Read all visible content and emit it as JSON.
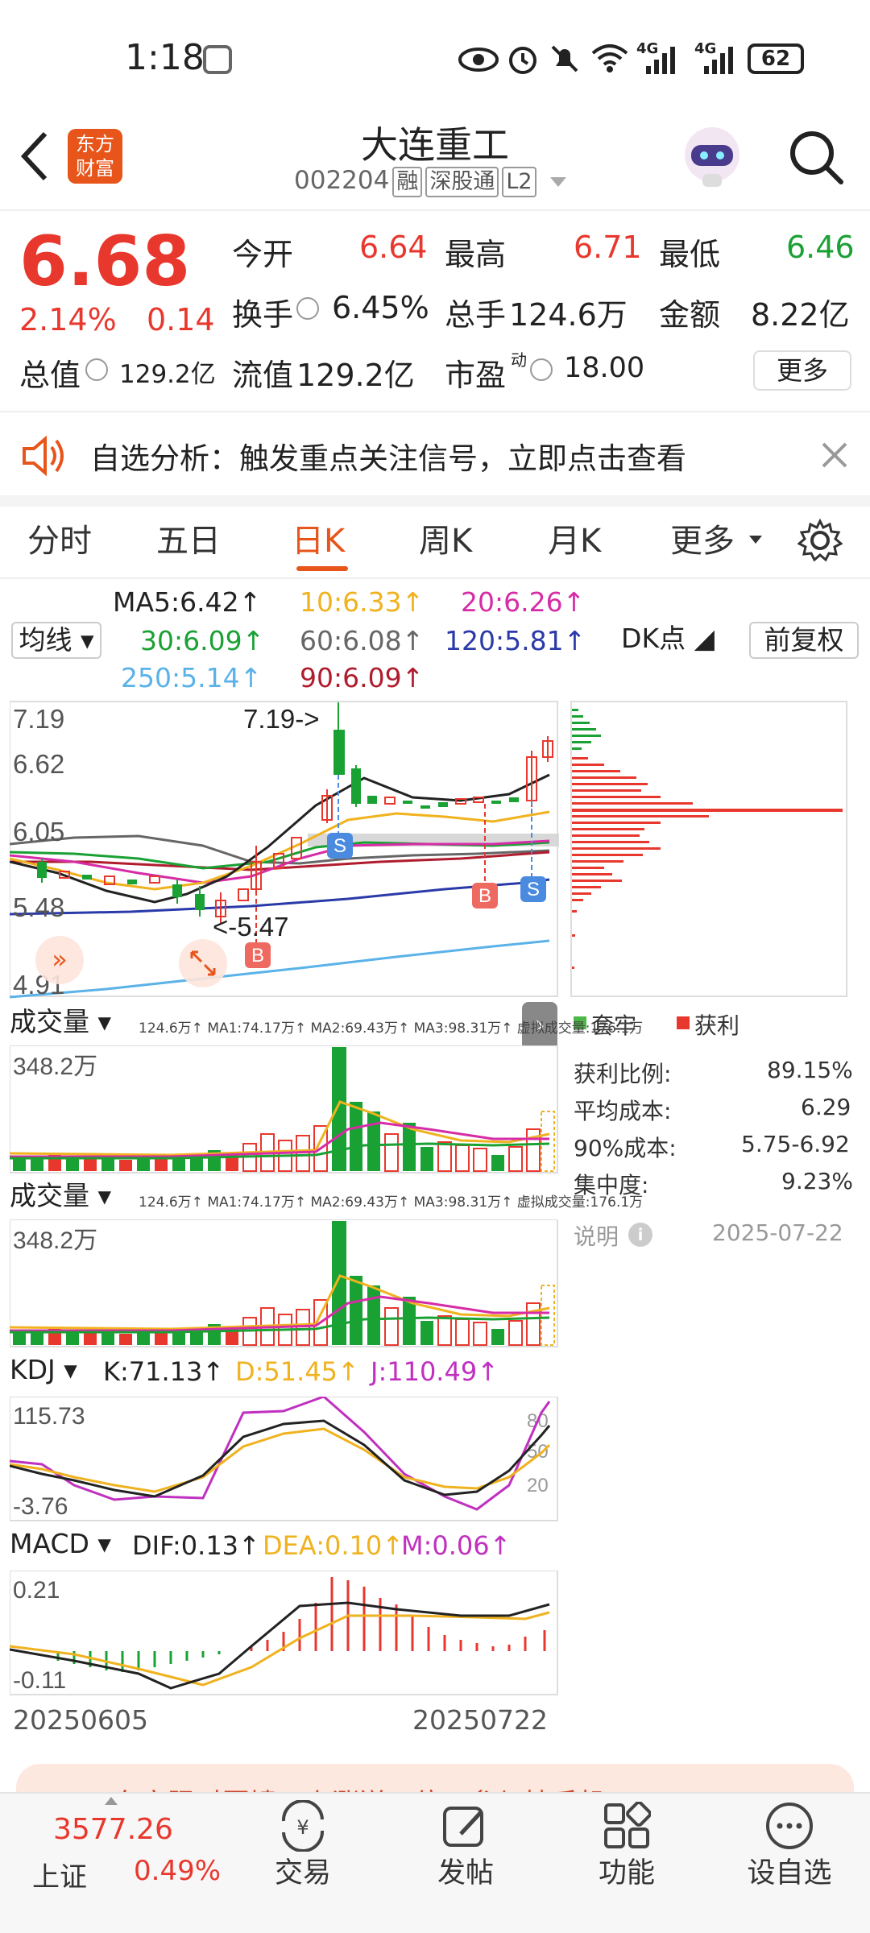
{
  "status": {
    "time": "1:18",
    "network": "4G",
    "network2": "4G",
    "battery": "62"
  },
  "header": {
    "stock_name": "大连重工",
    "stock_code": "002204",
    "tags": [
      "融",
      "深股通",
      "L2"
    ],
    "logo_line1": "东方",
    "logo_line2": "财富"
  },
  "quote": {
    "price": "6.68",
    "change_pct": "2.14%",
    "change": "0.14",
    "open_label": "今开",
    "open": "6.64",
    "high_label": "最高",
    "high": "6.71",
    "low_label": "最低",
    "low": "6.46",
    "turnover_label": "换手",
    "turnover": "6.45%",
    "volume_label": "总手",
    "volume": "124.6万",
    "amount_label": "金额",
    "amount": "8.22亿",
    "mktcap_label": "总值",
    "mktcap": "129.2亿",
    "float_label": "流值",
    "float": "129.2亿",
    "pe_label": "市盈",
    "pe_sup": "动",
    "pe": "18.00",
    "more_label": "更多"
  },
  "notice": {
    "text": "自选分析：触发重点关注信号，立即点击查看"
  },
  "tabs": [
    "分时",
    "五日",
    "日K",
    "周K",
    "月K",
    "更多"
  ],
  "active_tab": "日K",
  "ma": {
    "selector": "均线",
    "ma5": "MA5:6.42↑",
    "ma10": "10:6.33↑",
    "ma20": "20:6.26↑",
    "ma30": "30:6.09↑",
    "ma60": "60:6.08↑",
    "ma120": "120:5.81↑",
    "ma250": "250:5.14↑",
    "ma90": "90:6.09↑",
    "dk_label": "DK点",
    "fq_label": "前复权",
    "colors": {
      "ma5": "#222222",
      "ma10": "#f0b21e",
      "ma20": "#d62ca7",
      "ma30": "#1aa134",
      "ma60": "#666666",
      "ma120": "#2a3aa8",
      "ma250": "#5ab2e8",
      "ma90": "#b01c2e"
    }
  },
  "kline": {
    "y_labels": [
      "7.19",
      "6.62",
      "6.05",
      "5.48",
      "4.91"
    ],
    "high_annot": "7.19->",
    "low_annot": "<-5.47",
    "signals": [
      "S",
      "B",
      "B",
      "S"
    ]
  },
  "chip": {
    "legend_trapped": "套牢",
    "legend_profit": "获利",
    "profit_ratio_label": "获利比例:",
    "profit_ratio": "89.15%",
    "avg_cost_label": "平均成本:",
    "avg_cost": "6.29",
    "cost90_label": "90%成本:",
    "cost90": "5.75-6.92",
    "concentration_label": "集中度:",
    "concentration": "9.23%",
    "note_label": "说明",
    "date": "2025-07-22"
  },
  "vol1": {
    "selector": "成交量",
    "legend": "124.6万↑ MA1:74.17万↑ MA2:69.43万↑ MA3:98.31万↑ 虚拟成交量:176.1万",
    "y_label": "348.2万"
  },
  "vol2": {
    "selector": "成交量",
    "legend": "124.6万↑ MA1:74.17万↑ MA2:69.43万↑ MA3:98.31万↑ 虚拟成交量:176.1万",
    "y_label": "348.2万"
  },
  "kdj": {
    "selector": "KDJ",
    "k": "K:71.13↑",
    "d": "D:51.45↑",
    "j": "J:110.49↑",
    "y_top": "115.73",
    "y_bottom": "-3.76",
    "levels": [
      "80",
      "50",
      "20"
    ]
  },
  "macd": {
    "selector": "MACD",
    "dif": "DIF:0.13↑",
    "dea": "DEA:0.10↑",
    "m": "M:0.06↑",
    "y_top": "0.21",
    "y_bottom": "-0.11"
  },
  "x_axis": {
    "start": "20250605",
    "end": "20250722"
  },
  "banner": {
    "text": "东方限时回馈，上涨送五倍！参与抽手机"
  },
  "bottom_nav": {
    "index_value": "3577.26",
    "index_name": "上证",
    "index_change": "0.49%",
    "items": [
      "交易",
      "发帖",
      "功能",
      "设自选"
    ]
  }
}
